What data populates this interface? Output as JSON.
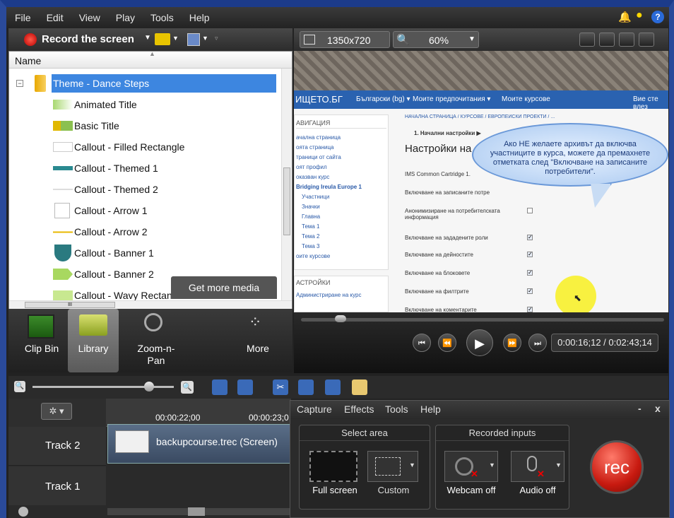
{
  "menu": [
    "File",
    "Edit",
    "View",
    "Play",
    "Tools",
    "Help"
  ],
  "toolbar": {
    "record": "Record the screen",
    "dims": "1350x720",
    "zoom": "60%"
  },
  "library": {
    "header": "Name",
    "items": [
      "Theme - Dance Steps",
      "Animated Title",
      "Basic Title",
      "Callout - Filled Rectangle",
      "Callout - Themed 1",
      "Callout - Themed 2",
      "Callout - Arrow 1",
      "Callout - Arrow 2",
      "Callout - Banner 1",
      "Callout - Banner 2",
      "Callout - Wavy Rectan"
    ],
    "get_more": "Get more media",
    "scroll_mark": "III"
  },
  "tabs": [
    "Clip Bin",
    "Library",
    "Zoom-n-\nPan",
    "More"
  ],
  "preview": {
    "site": "ИЩЕТО.БГ",
    "lang": "Български (bg) ▾",
    "prefs": "Моите предпочитания ▾",
    "courses": "Моите курсове",
    "right": "Вие сте влез",
    "crumbs": "НАЧАЛНА СТРАНИЦА / КУРСОВЕ / ЕВРОПЕЙСКИ ПРОЕКТИ / ...",
    "nav_title": "АВИГАЦИЯ",
    "nav": [
      "ачална страница",
      "оята страница",
      "траници от сайта",
      "оят профил",
      "оказван курс",
      "Bridging Ireula Europe 1",
      "Участници",
      "Значки",
      "Главна",
      "Тема 1",
      "Тема 2",
      "Тема 3",
      "оите курсове"
    ],
    "step": "1. Начални настройки ▶",
    "heading": "Настройки на ар",
    "rows": [
      "IMS Common Cartridge 1.",
      "Включване на записаните потре",
      "Анонимизиране на потребителската информация",
      "Включване на зададените роли",
      "Включване на дейностите",
      "Включване на блоковете",
      "Включване на филтрите",
      "Включване на коментарите"
    ],
    "settings": "АСТРОЙКИ",
    "admin": "Администриране на курс",
    "bubble": "Ако НЕ желаете архивът да включва участниците в курса, можете да премахнете отметката след \"Включване на записаните потребители\"."
  },
  "player": {
    "time": "0:00:16;12 / 0:02:43;14"
  },
  "timeline": {
    "t1": "00:00:22;00",
    "t2": "00:00:23;0",
    "track2": "Track 2",
    "track1": "Track 1",
    "clip": "backupcourse.trec (Screen)"
  },
  "recorder": {
    "menu": [
      "Capture",
      "Effects",
      "Tools",
      "Help"
    ],
    "select_area": "Select area",
    "recorded_inputs": "Recorded inputs",
    "full": "Full screen",
    "custom": "Custom",
    "webcam": "Webcam off",
    "audio": "Audio off",
    "rec": "rec",
    "min": "-",
    "close": "x"
  }
}
